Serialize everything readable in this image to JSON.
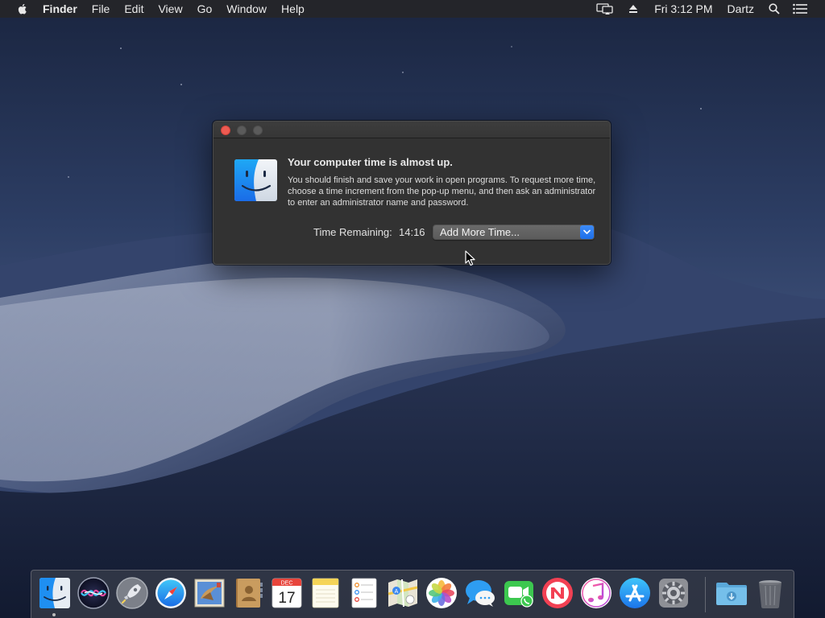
{
  "menubar": {
    "app_name": "Finder",
    "items": [
      "File",
      "Edit",
      "View",
      "Go",
      "Window",
      "Help"
    ],
    "clock": "Fri 3:12 PM",
    "user": "Dartz",
    "status_icons": [
      "airplay-display-icon",
      "eject-icon",
      "spotlight-search-icon",
      "notification-center-icon"
    ]
  },
  "dialog": {
    "headline": "Your computer time is almost up.",
    "body": "You should finish and save your work in open programs. To request more time, choose a time increment from the pop-up menu, and then ask an administrator to enter an administrator name and password.",
    "time_remaining_label": "Time Remaining:",
    "time_remaining_value": "14:16",
    "popup_selected": "Add More Time..."
  },
  "dock": {
    "apps": [
      {
        "name": "Finder",
        "icon": "finder-icon",
        "running": true
      },
      {
        "name": "Siri",
        "icon": "siri-icon"
      },
      {
        "name": "Launchpad",
        "icon": "launchpad-icon"
      },
      {
        "name": "Safari",
        "icon": "safari-icon"
      },
      {
        "name": "Mail",
        "icon": "mail-icon"
      },
      {
        "name": "Contacts",
        "icon": "contacts-icon"
      },
      {
        "name": "Calendar",
        "icon": "calendar-icon",
        "month": "DEC",
        "day": "17"
      },
      {
        "name": "Notes",
        "icon": "notes-icon"
      },
      {
        "name": "Reminders",
        "icon": "reminders-icon"
      },
      {
        "name": "Maps",
        "icon": "maps-icon"
      },
      {
        "name": "Photos",
        "icon": "photos-icon"
      },
      {
        "name": "Messages",
        "icon": "messages-icon"
      },
      {
        "name": "FaceTime",
        "icon": "facetime-icon"
      },
      {
        "name": "News",
        "icon": "news-icon"
      },
      {
        "name": "iTunes",
        "icon": "itunes-icon"
      },
      {
        "name": "App Store",
        "icon": "app-store-icon"
      },
      {
        "name": "System Preferences",
        "icon": "system-preferences-icon"
      },
      {
        "name": "Downloads",
        "icon": "downloads-folder-icon"
      },
      {
        "name": "Trash",
        "icon": "trash-icon"
      }
    ]
  },
  "colors": {
    "close_button": "#ee5b52",
    "popup_arrow": "#1e6fe8",
    "dialog_background": "#323232",
    "menubar_background": "#24252a"
  }
}
